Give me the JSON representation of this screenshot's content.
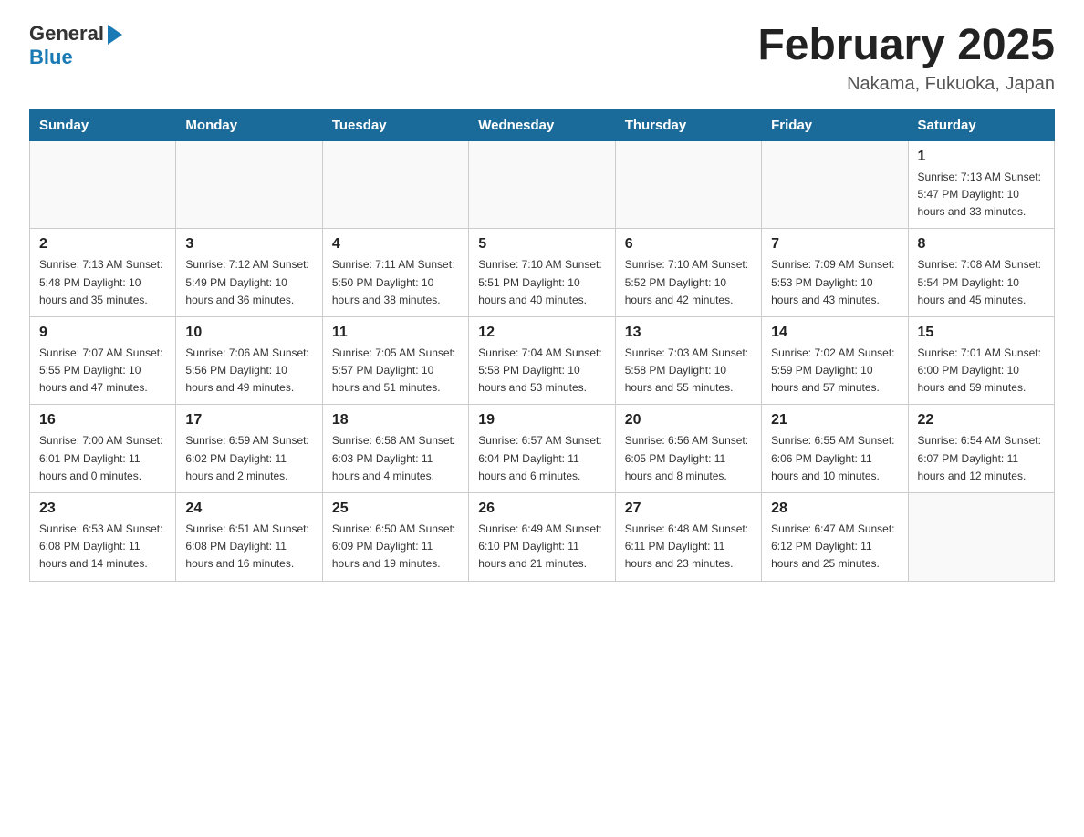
{
  "header": {
    "logo_general": "General",
    "logo_blue": "Blue",
    "title": "February 2025",
    "subtitle": "Nakama, Fukuoka, Japan"
  },
  "days_of_week": [
    "Sunday",
    "Monday",
    "Tuesday",
    "Wednesday",
    "Thursday",
    "Friday",
    "Saturday"
  ],
  "weeks": [
    [
      {
        "day": "",
        "info": ""
      },
      {
        "day": "",
        "info": ""
      },
      {
        "day": "",
        "info": ""
      },
      {
        "day": "",
        "info": ""
      },
      {
        "day": "",
        "info": ""
      },
      {
        "day": "",
        "info": ""
      },
      {
        "day": "1",
        "info": "Sunrise: 7:13 AM\nSunset: 5:47 PM\nDaylight: 10 hours\nand 33 minutes."
      }
    ],
    [
      {
        "day": "2",
        "info": "Sunrise: 7:13 AM\nSunset: 5:48 PM\nDaylight: 10 hours\nand 35 minutes."
      },
      {
        "day": "3",
        "info": "Sunrise: 7:12 AM\nSunset: 5:49 PM\nDaylight: 10 hours\nand 36 minutes."
      },
      {
        "day": "4",
        "info": "Sunrise: 7:11 AM\nSunset: 5:50 PM\nDaylight: 10 hours\nand 38 minutes."
      },
      {
        "day": "5",
        "info": "Sunrise: 7:10 AM\nSunset: 5:51 PM\nDaylight: 10 hours\nand 40 minutes."
      },
      {
        "day": "6",
        "info": "Sunrise: 7:10 AM\nSunset: 5:52 PM\nDaylight: 10 hours\nand 42 minutes."
      },
      {
        "day": "7",
        "info": "Sunrise: 7:09 AM\nSunset: 5:53 PM\nDaylight: 10 hours\nand 43 minutes."
      },
      {
        "day": "8",
        "info": "Sunrise: 7:08 AM\nSunset: 5:54 PM\nDaylight: 10 hours\nand 45 minutes."
      }
    ],
    [
      {
        "day": "9",
        "info": "Sunrise: 7:07 AM\nSunset: 5:55 PM\nDaylight: 10 hours\nand 47 minutes."
      },
      {
        "day": "10",
        "info": "Sunrise: 7:06 AM\nSunset: 5:56 PM\nDaylight: 10 hours\nand 49 minutes."
      },
      {
        "day": "11",
        "info": "Sunrise: 7:05 AM\nSunset: 5:57 PM\nDaylight: 10 hours\nand 51 minutes."
      },
      {
        "day": "12",
        "info": "Sunrise: 7:04 AM\nSunset: 5:58 PM\nDaylight: 10 hours\nand 53 minutes."
      },
      {
        "day": "13",
        "info": "Sunrise: 7:03 AM\nSunset: 5:58 PM\nDaylight: 10 hours\nand 55 minutes."
      },
      {
        "day": "14",
        "info": "Sunrise: 7:02 AM\nSunset: 5:59 PM\nDaylight: 10 hours\nand 57 minutes."
      },
      {
        "day": "15",
        "info": "Sunrise: 7:01 AM\nSunset: 6:00 PM\nDaylight: 10 hours\nand 59 minutes."
      }
    ],
    [
      {
        "day": "16",
        "info": "Sunrise: 7:00 AM\nSunset: 6:01 PM\nDaylight: 11 hours\nand 0 minutes."
      },
      {
        "day": "17",
        "info": "Sunrise: 6:59 AM\nSunset: 6:02 PM\nDaylight: 11 hours\nand 2 minutes."
      },
      {
        "day": "18",
        "info": "Sunrise: 6:58 AM\nSunset: 6:03 PM\nDaylight: 11 hours\nand 4 minutes."
      },
      {
        "day": "19",
        "info": "Sunrise: 6:57 AM\nSunset: 6:04 PM\nDaylight: 11 hours\nand 6 minutes."
      },
      {
        "day": "20",
        "info": "Sunrise: 6:56 AM\nSunset: 6:05 PM\nDaylight: 11 hours\nand 8 minutes."
      },
      {
        "day": "21",
        "info": "Sunrise: 6:55 AM\nSunset: 6:06 PM\nDaylight: 11 hours\nand 10 minutes."
      },
      {
        "day": "22",
        "info": "Sunrise: 6:54 AM\nSunset: 6:07 PM\nDaylight: 11 hours\nand 12 minutes."
      }
    ],
    [
      {
        "day": "23",
        "info": "Sunrise: 6:53 AM\nSunset: 6:08 PM\nDaylight: 11 hours\nand 14 minutes."
      },
      {
        "day": "24",
        "info": "Sunrise: 6:51 AM\nSunset: 6:08 PM\nDaylight: 11 hours\nand 16 minutes."
      },
      {
        "day": "25",
        "info": "Sunrise: 6:50 AM\nSunset: 6:09 PM\nDaylight: 11 hours\nand 19 minutes."
      },
      {
        "day": "26",
        "info": "Sunrise: 6:49 AM\nSunset: 6:10 PM\nDaylight: 11 hours\nand 21 minutes."
      },
      {
        "day": "27",
        "info": "Sunrise: 6:48 AM\nSunset: 6:11 PM\nDaylight: 11 hours\nand 23 minutes."
      },
      {
        "day": "28",
        "info": "Sunrise: 6:47 AM\nSunset: 6:12 PM\nDaylight: 11 hours\nand 25 minutes."
      },
      {
        "day": "",
        "info": ""
      }
    ]
  ],
  "accent_color": "#1a6b9a"
}
